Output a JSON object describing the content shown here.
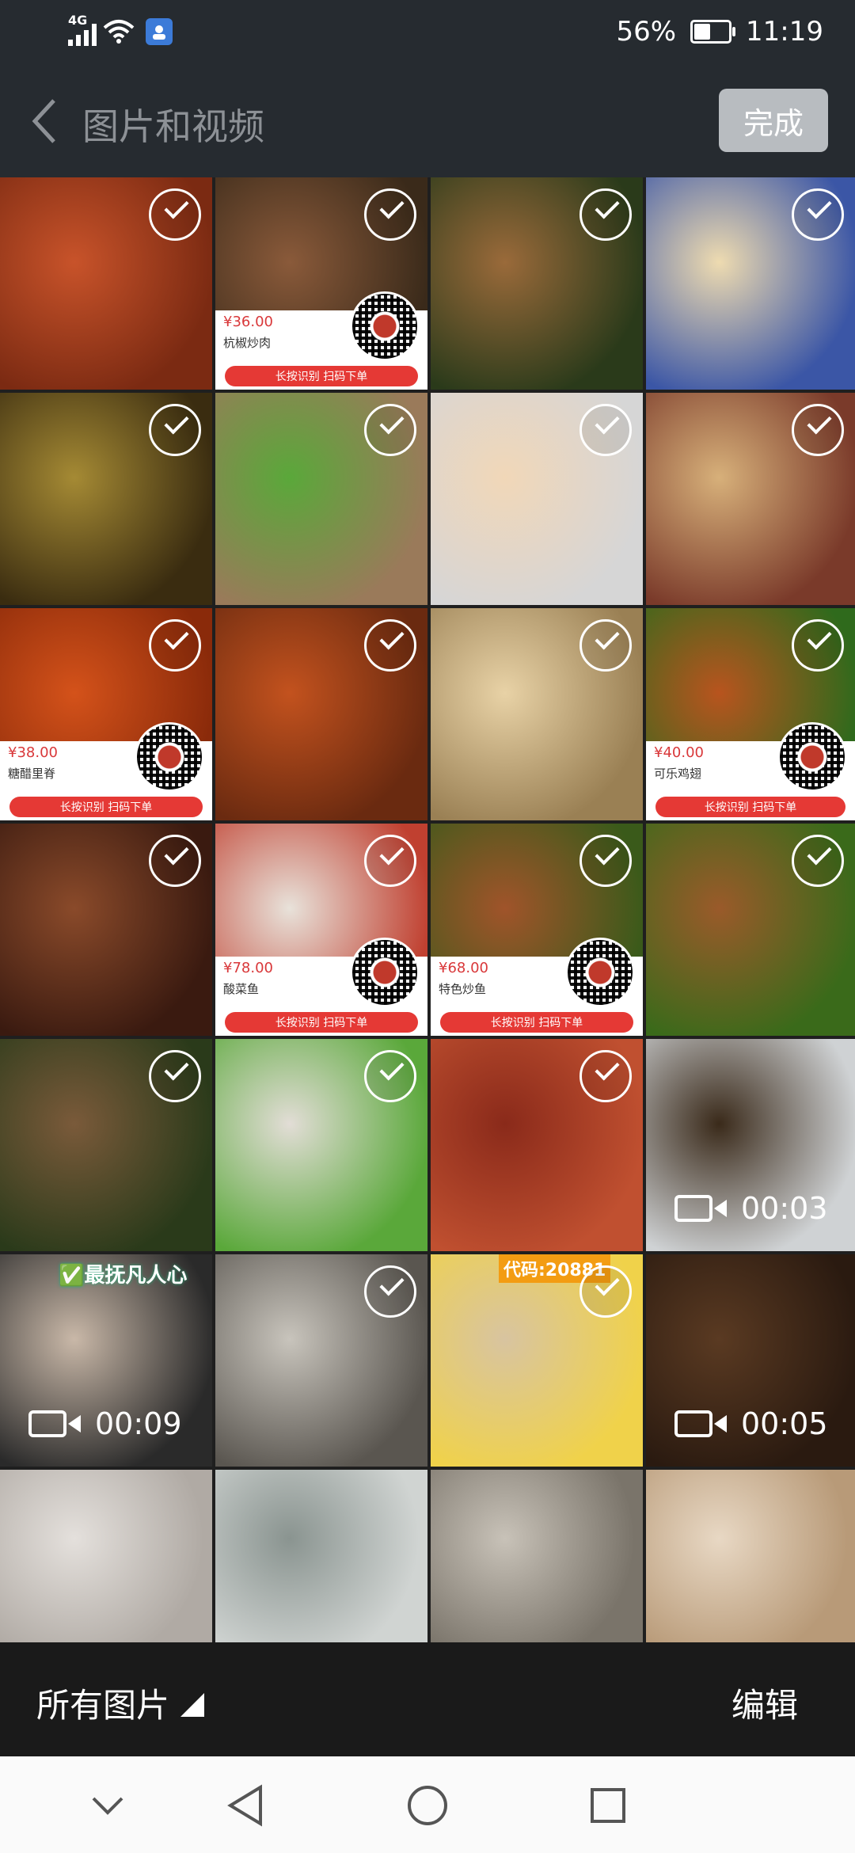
{
  "status_bar": {
    "network": "4G",
    "battery": "56%",
    "battery_fraction": 0.56,
    "time": "11:19"
  },
  "header": {
    "title": "图片和视频",
    "done_label": "完成"
  },
  "grid": {
    "cells": [
      {
        "r": 0,
        "c": 0,
        "colors": [
          "#e9e4dc",
          "#b6a88e"
        ],
        "partial": true,
        "selected": false
      },
      {
        "r": 0,
        "c": 1,
        "colors": [
          "#f5f0e6",
          "#e0a640"
        ],
        "partial": true,
        "selected": false
      },
      {
        "r": 0,
        "c": 2,
        "colors": [
          "#2f5a20",
          "#c7b48a"
        ],
        "partial": true,
        "selected": false
      },
      {
        "r": 0,
        "c": 3,
        "colors": [
          "#e8b454",
          "#a87a34"
        ],
        "partial": true,
        "selected": false
      },
      {
        "r": 1,
        "c": 0,
        "colors": [
          "#c8532a",
          "#7b2a12"
        ],
        "selected": true
      },
      {
        "r": 1,
        "c": 1,
        "colors": [
          "#8a5a3a",
          "#3a2a1a"
        ],
        "selected": true,
        "card": {
          "price": "¥36.00",
          "name": "杭椒炒肉",
          "bar": "长按识别 扫码下单"
        }
      },
      {
        "r": 1,
        "c": 2,
        "colors": [
          "#9a6a3a",
          "#2a3a1a"
        ],
        "selected": true
      },
      {
        "r": 1,
        "c": 3,
        "colors": [
          "#eedbb0",
          "#3b56a6"
        ],
        "selected": true
      },
      {
        "r": 2,
        "c": 0,
        "colors": [
          "#a58a34",
          "#3a2c10"
        ],
        "selected": true
      },
      {
        "r": 2,
        "c": 1,
        "colors": [
          "#5aa83a",
          "#9a7a5a"
        ],
        "selected": true
      },
      {
        "r": 2,
        "c": 2,
        "colors": [
          "#f1d7b8",
          "#d6d6d6"
        ],
        "selected": true
      },
      {
        "r": 2,
        "c": 3,
        "colors": [
          "#d7b07a",
          "#7a3a2a"
        ],
        "selected": true
      },
      {
        "r": 3,
        "c": 0,
        "colors": [
          "#d4521a",
          "#8a2a0a"
        ],
        "selected": true,
        "card": {
          "price": "¥38.00",
          "name": "糖醋里脊",
          "bar": "长按识别 扫码下单"
        }
      },
      {
        "r": 3,
        "c": 1,
        "colors": [
          "#c3521e",
          "#6a2a10"
        ],
        "selected": true
      },
      {
        "r": 3,
        "c": 2,
        "colors": [
          "#e8d2a6",
          "#9a8054"
        ],
        "selected": true
      },
      {
        "r": 3,
        "c": 3,
        "colors": [
          "#b8541e",
          "#2f6a1c"
        ],
        "selected": true,
        "card": {
          "price": "¥40.00",
          "name": "可乐鸡翅",
          "bar": "长按识别 扫码下单"
        }
      },
      {
        "r": 4,
        "c": 0,
        "colors": [
          "#8a4a2a",
          "#3a1a10"
        ],
        "selected": true
      },
      {
        "r": 4,
        "c": 1,
        "colors": [
          "#e8e2da",
          "#c04030"
        ],
        "selected": true,
        "card": {
          "price": "¥78.00",
          "name": "酸菜鱼",
          "bar": "长按识别 扫码下单"
        }
      },
      {
        "r": 4,
        "c": 2,
        "colors": [
          "#a0542a",
          "#3a5a1a"
        ],
        "selected": true,
        "card": {
          "price": "¥68.00",
          "name": "特色炒鱼",
          "bar": "长按识别 扫码下单"
        }
      },
      {
        "r": 4,
        "c": 3,
        "colors": [
          "#9a5a2a",
          "#3a6a1a"
        ],
        "selected": true
      },
      {
        "r": 5,
        "c": 0,
        "colors": [
          "#7a5a3a",
          "#2a3a1a"
        ],
        "selected": true
      },
      {
        "r": 5,
        "c": 1,
        "colors": [
          "#e2ddd6",
          "#5aa83a"
        ],
        "selected": true
      },
      {
        "r": 5,
        "c": 2,
        "colors": [
          "#8a2a1a",
          "#c05030"
        ],
        "selected": true
      },
      {
        "r": 5,
        "c": 3,
        "colors": [
          "#3a2a1a",
          "#cfd2d4"
        ],
        "selected": false,
        "video": "00:03"
      },
      {
        "r": 6,
        "c": 0,
        "colors": [
          "#c9b8a8",
          "#2a2a2a"
        ],
        "selected": false,
        "video": "00:09",
        "overlay": "✅最抚凡人心"
      },
      {
        "r": 6,
        "c": 1,
        "colors": [
          "#c8c4bc",
          "#5a5650"
        ],
        "selected": true
      },
      {
        "r": 6,
        "c": 2,
        "colors": [
          "#d8c4a0",
          "#f0d24a"
        ],
        "selected": true,
        "code": "代码:20881"
      },
      {
        "r": 6,
        "c": 3,
        "colors": [
          "#5a3a22",
          "#2a1a10"
        ],
        "selected": false,
        "video": "00:05"
      },
      {
        "r": 7,
        "c": 0,
        "colors": [
          "#e4e0dc",
          "#b0aaa4"
        ],
        "partial": true,
        "selected": false
      },
      {
        "r": 7,
        "c": 1,
        "colors": [
          "#8a9490",
          "#d0d4d2"
        ],
        "partial": true,
        "selected": false
      },
      {
        "r": 7,
        "c": 2,
        "colors": [
          "#c8c2b8",
          "#7a746a"
        ],
        "partial": true,
        "selected": false
      },
      {
        "r": 7,
        "c": 3,
        "colors": [
          "#e8d8c4",
          "#b89a78"
        ],
        "partial": true,
        "selected": false
      }
    ]
  },
  "bottom_bar": {
    "album_label": "所有图片",
    "edit_label": "编辑"
  },
  "nav": {
    "icons": [
      "chevron-down-icon",
      "back-triangle-icon",
      "home-circle-icon",
      "recents-square-icon"
    ]
  }
}
